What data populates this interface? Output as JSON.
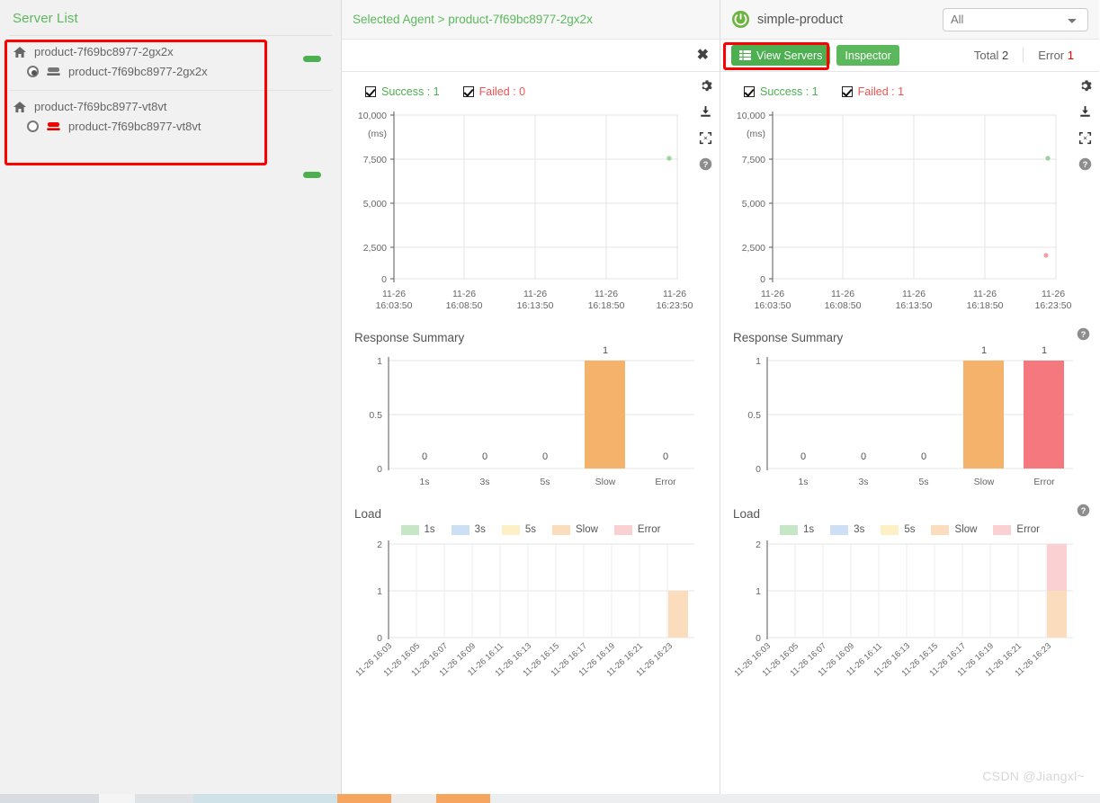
{
  "sidebar": {
    "title": "Server List",
    "groups": [
      {
        "host": "product-7f69bc8977-2gx2x",
        "instance": "product-7f69bc8977-2gx2x",
        "selected": true,
        "status": "ok"
      },
      {
        "host": "product-7f69bc8977-vt8vt",
        "instance": "product-7f69bc8977-vt8vt",
        "selected": false,
        "status": "error"
      }
    ]
  },
  "center_panel": {
    "breadcrumb": "Selected Agent > product-7f69bc8977-2gx2x",
    "close_label": "✖",
    "scatter": {
      "success_label": "Success : 1",
      "failed_label": "Failed : 0"
    },
    "response_summary_title": "Response Summary",
    "load_title": "Load"
  },
  "right_panel": {
    "app_name": "simple-product",
    "filter_value": "All",
    "tabs": [
      {
        "label": "View Servers",
        "active": true
      },
      {
        "label": "Inspector",
        "active": false
      }
    ],
    "total_label": "Total",
    "total_value": "2",
    "error_label": "Error",
    "error_value": "1",
    "scatter": {
      "success_label": "Success : 1",
      "failed_label": "Failed : 1"
    },
    "response_summary_title": "Response Summary",
    "load_title": "Load"
  },
  "colors": {
    "green": "#4caf50",
    "red": "#f05252",
    "orange": "#f5b26b",
    "slow_light": "#fbdcbc",
    "error_light": "#fbd0d2",
    "annotation": "#fe0000"
  },
  "watermark": "CSDN @Jiangxl~",
  "chart_data": [
    {
      "type": "scatter",
      "title": "",
      "panel": "center",
      "ylabel": "(ms)",
      "ylim": [
        0,
        10000
      ],
      "yticks": [
        "0",
        "2,500",
        "5,000",
        "7,500",
        "10,000"
      ],
      "xticks": [
        "11-26\n16:03:50",
        "11-26\n16:08:50",
        "11-26\n16:13:50",
        "11-26\n16:18:50",
        "11-26\n16:23:50"
      ],
      "xtick_labels": [
        [
          "11-26",
          "16:03:50"
        ],
        [
          "11-26",
          "16:08:50"
        ],
        [
          "11-26",
          "16:13:50"
        ],
        [
          "11-26",
          "16:18:50"
        ],
        [
          "11-26",
          "16:23:50"
        ]
      ],
      "series": [
        {
          "name": "Success",
          "color": "#9cd39c",
          "points": [
            {
              "x": 4.9,
              "y": 7550
            }
          ]
        }
      ],
      "grid": true,
      "legend": [
        "Success : 1",
        "Failed : 0"
      ]
    },
    {
      "type": "scatter",
      "title": "",
      "panel": "right",
      "ylabel": "(ms)",
      "ylim": [
        0,
        10000
      ],
      "yticks": [
        "0",
        "2,500",
        "5,000",
        "7,500",
        "10,000"
      ],
      "xtick_labels": [
        [
          "11-26",
          "16:03:50"
        ],
        [
          "11-26",
          "16:08:50"
        ],
        [
          "11-26",
          "16:13:50"
        ],
        [
          "11-26",
          "16:18:50"
        ],
        [
          "11-26",
          "16:23:50"
        ]
      ],
      "series": [
        {
          "name": "Success",
          "color": "#9cd39c",
          "points": [
            {
              "x": 4.9,
              "y": 7550
            }
          ]
        },
        {
          "name": "Failed",
          "color": "#f4a0a4",
          "points": [
            {
              "x": 4.85,
              "y": 2100
            }
          ]
        }
      ],
      "grid": true,
      "legend": [
        "Success : 1",
        "Failed : 1"
      ]
    },
    {
      "type": "bar",
      "title": "Response Summary",
      "panel": "center",
      "categories": [
        "1s",
        "3s",
        "5s",
        "Slow",
        "Error"
      ],
      "values": [
        0,
        0,
        0,
        1,
        0
      ],
      "colors": [
        "#a8d9a8",
        "#a9c8ec",
        "#f5dc8e",
        "#f5b26b",
        "#f4787e"
      ],
      "ylim": [
        0,
        1
      ],
      "yticks": [
        "0",
        "0.5",
        "1"
      ],
      "ylabel": "",
      "xlabel": ""
    },
    {
      "type": "bar",
      "title": "Response Summary",
      "panel": "right",
      "categories": [
        "1s",
        "3s",
        "5s",
        "Slow",
        "Error"
      ],
      "values": [
        0,
        0,
        0,
        1,
        1
      ],
      "colors": [
        "#a8d9a8",
        "#a9c8ec",
        "#f5dc8e",
        "#f5b26b",
        "#f4787e"
      ],
      "ylim": [
        0,
        1
      ],
      "yticks": [
        "0",
        "0.5",
        "1"
      ],
      "ylabel": "",
      "xlabel": ""
    },
    {
      "type": "bar",
      "title": "Load",
      "panel": "center",
      "stacked": true,
      "legend": [
        "1s",
        "3s",
        "5s",
        "Slow",
        "Error"
      ],
      "legend_colors": [
        "#c6e7c6",
        "#cddff5",
        "#fdf0c4",
        "#fbdcbc",
        "#fbd0d2"
      ],
      "categories": [
        "11-26 16:03",
        "11-26 16:05",
        "11-26 16:07",
        "11-26 16:09",
        "11-26 16:11",
        "11-26 16:13",
        "11-26 16:15",
        "11-26 16:17",
        "11-26 16:19",
        "11-26 16:21",
        "11-26 16:23"
      ],
      "ylim": [
        0,
        2
      ],
      "yticks": [
        "0",
        "1",
        "2"
      ],
      "series": [
        {
          "name": "1s",
          "values": [
            0,
            0,
            0,
            0,
            0,
            0,
            0,
            0,
            0,
            0,
            0
          ]
        },
        {
          "name": "3s",
          "values": [
            0,
            0,
            0,
            0,
            0,
            0,
            0,
            0,
            0,
            0,
            0
          ]
        },
        {
          "name": "5s",
          "values": [
            0,
            0,
            0,
            0,
            0,
            0,
            0,
            0,
            0,
            0,
            0
          ]
        },
        {
          "name": "Slow",
          "values": [
            0,
            0,
            0,
            0,
            0,
            0,
            0,
            0,
            0,
            0,
            1
          ]
        },
        {
          "name": "Error",
          "values": [
            0,
            0,
            0,
            0,
            0,
            0,
            0,
            0,
            0,
            0,
            0
          ]
        }
      ]
    },
    {
      "type": "bar",
      "title": "Load",
      "panel": "right",
      "stacked": true,
      "legend": [
        "1s",
        "3s",
        "5s",
        "Slow",
        "Error"
      ],
      "legend_colors": [
        "#c6e7c6",
        "#cddff5",
        "#fdf0c4",
        "#fbdcbc",
        "#fbd0d2"
      ],
      "categories": [
        "11-26 16:03",
        "11-26 16:05",
        "11-26 16:07",
        "11-26 16:09",
        "11-26 16:11",
        "11-26 16:13",
        "11-26 16:15",
        "11-26 16:17",
        "11-26 16:19",
        "11-26 16:21",
        "11-26 16:23"
      ],
      "ylim": [
        0,
        2
      ],
      "yticks": [
        "0",
        "1",
        "2"
      ],
      "series": [
        {
          "name": "1s",
          "values": [
            0,
            0,
            0,
            0,
            0,
            0,
            0,
            0,
            0,
            0,
            0
          ]
        },
        {
          "name": "3s",
          "values": [
            0,
            0,
            0,
            0,
            0,
            0,
            0,
            0,
            0,
            0,
            0
          ]
        },
        {
          "name": "5s",
          "values": [
            0,
            0,
            0,
            0,
            0,
            0,
            0,
            0,
            0,
            0,
            0
          ]
        },
        {
          "name": "Slow",
          "values": [
            0,
            0,
            0,
            0,
            0,
            0,
            0,
            0,
            0,
            0,
            1
          ]
        },
        {
          "name": "Error",
          "values": [
            0,
            0,
            0,
            0,
            0,
            0,
            0,
            0,
            0,
            0,
            1
          ]
        }
      ]
    }
  ]
}
